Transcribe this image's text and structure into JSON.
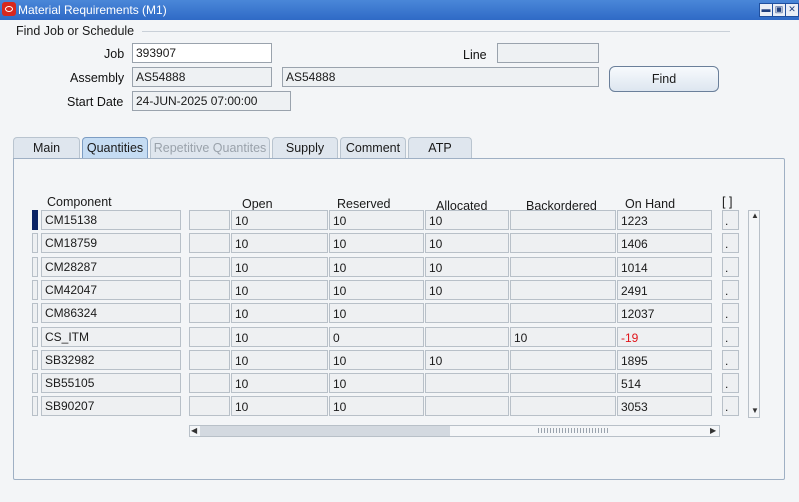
{
  "window": {
    "title": "Material Requirements (M1)",
    "buttons": {
      "minimize": "▬",
      "maximize": "▣",
      "close": "✕"
    }
  },
  "find_group": {
    "title": "Find Job or Schedule",
    "job_label": "Job",
    "job_value": "393907",
    "line_label": "Line",
    "line_value": "",
    "assembly_label": "Assembly",
    "assembly_value": "AS54888",
    "assembly_desc": "AS54888",
    "start_date_label": "Start Date",
    "start_date_value": "24-JUN-2025 07:00:00",
    "find_button": "Find"
  },
  "tabs": [
    {
      "label": "Main",
      "state": "normal"
    },
    {
      "label": "Quantities",
      "state": "active"
    },
    {
      "label": "Repetitive Quantites",
      "state": "disabled"
    },
    {
      "label": "Supply",
      "state": "normal"
    },
    {
      "label": "Comment",
      "state": "normal"
    },
    {
      "label": "ATP",
      "state": "normal"
    }
  ],
  "grid": {
    "headers": {
      "component": "Component",
      "open": "Open",
      "reserved": "Reserved",
      "allocated": "Allocated",
      "backordered": "Backordered",
      "on_hand": "On Hand",
      "flex": "[ ]"
    },
    "rows": [
      {
        "component": "CM15138",
        "open": "10",
        "reserved": "10",
        "allocated": "10",
        "backordered": "",
        "on_hand": "1223"
      },
      {
        "component": "CM18759",
        "open": "10",
        "reserved": "10",
        "allocated": "10",
        "backordered": "",
        "on_hand": "1406"
      },
      {
        "component": "CM28287",
        "open": "10",
        "reserved": "10",
        "allocated": "10",
        "backordered": "",
        "on_hand": "1014"
      },
      {
        "component": "CM42047",
        "open": "10",
        "reserved": "10",
        "allocated": "10",
        "backordered": "",
        "on_hand": "2491"
      },
      {
        "component": "CM86324",
        "open": "10",
        "reserved": "10",
        "allocated": "",
        "backordered": "",
        "on_hand": "12037"
      },
      {
        "component": "CS_ITM",
        "open": "10",
        "reserved": "0",
        "allocated": "",
        "backordered": "10",
        "on_hand": "-19"
      },
      {
        "component": "SB32982",
        "open": "10",
        "reserved": "10",
        "allocated": "10",
        "backordered": "",
        "on_hand": "1895"
      },
      {
        "component": "SB55105",
        "open": "10",
        "reserved": "10",
        "allocated": "",
        "backordered": "",
        "on_hand": "514"
      },
      {
        "component": "SB90207",
        "open": "10",
        "reserved": "10",
        "allocated": "",
        "backordered": "",
        "on_hand": "3053"
      }
    ],
    "current_row_index": 0,
    "negative_color": "#e0141a",
    "flex_cell_text": "."
  },
  "scrollbars": {
    "up": "▲",
    "down": "▼",
    "left": "◀",
    "right": "▶"
  },
  "colors": {
    "titlebar": "#2f6ac6",
    "active_tab": "#c5dcf3",
    "current_row": "#0b2466"
  }
}
